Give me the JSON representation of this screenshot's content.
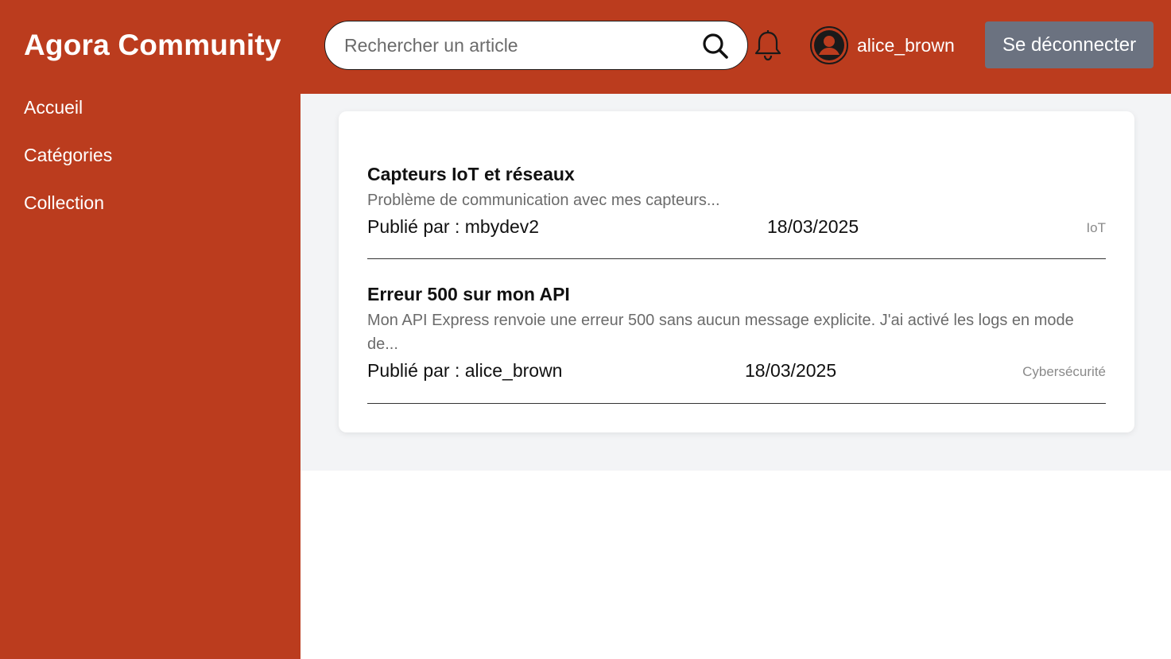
{
  "app": {
    "title": "Agora Community"
  },
  "search": {
    "placeholder": "Rechercher un article"
  },
  "user": {
    "username": "alice_brown"
  },
  "header": {
    "logout_label": "Se déconnecter"
  },
  "sidebar": {
    "items": [
      {
        "label": "Accueil"
      },
      {
        "label": "Catégories"
      },
      {
        "label": "Collection"
      }
    ]
  },
  "articles": [
    {
      "title": "Capteurs IoT et réseaux",
      "excerpt": "Problème de communication avec mes capteurs...",
      "author": "Publié par : mbydev2",
      "date": "18/03/2025",
      "category": "IoT"
    },
    {
      "title": "Erreur 500 sur mon API",
      "excerpt": "Mon API Express renvoie une erreur 500 sans aucun message explicite. J'ai activé les logs en mode de...",
      "author": "Publié par : alice_brown",
      "date": "18/03/2025",
      "category": "Cybersécurité"
    }
  ],
  "colors": {
    "brand": "#bb3c1e",
    "logout_button": "#6b7280",
    "content_background": "#f3f4f6"
  },
  "icons": {
    "search": "search-icon",
    "notifications": "bell-icon",
    "avatar": "user-avatar-icon"
  }
}
